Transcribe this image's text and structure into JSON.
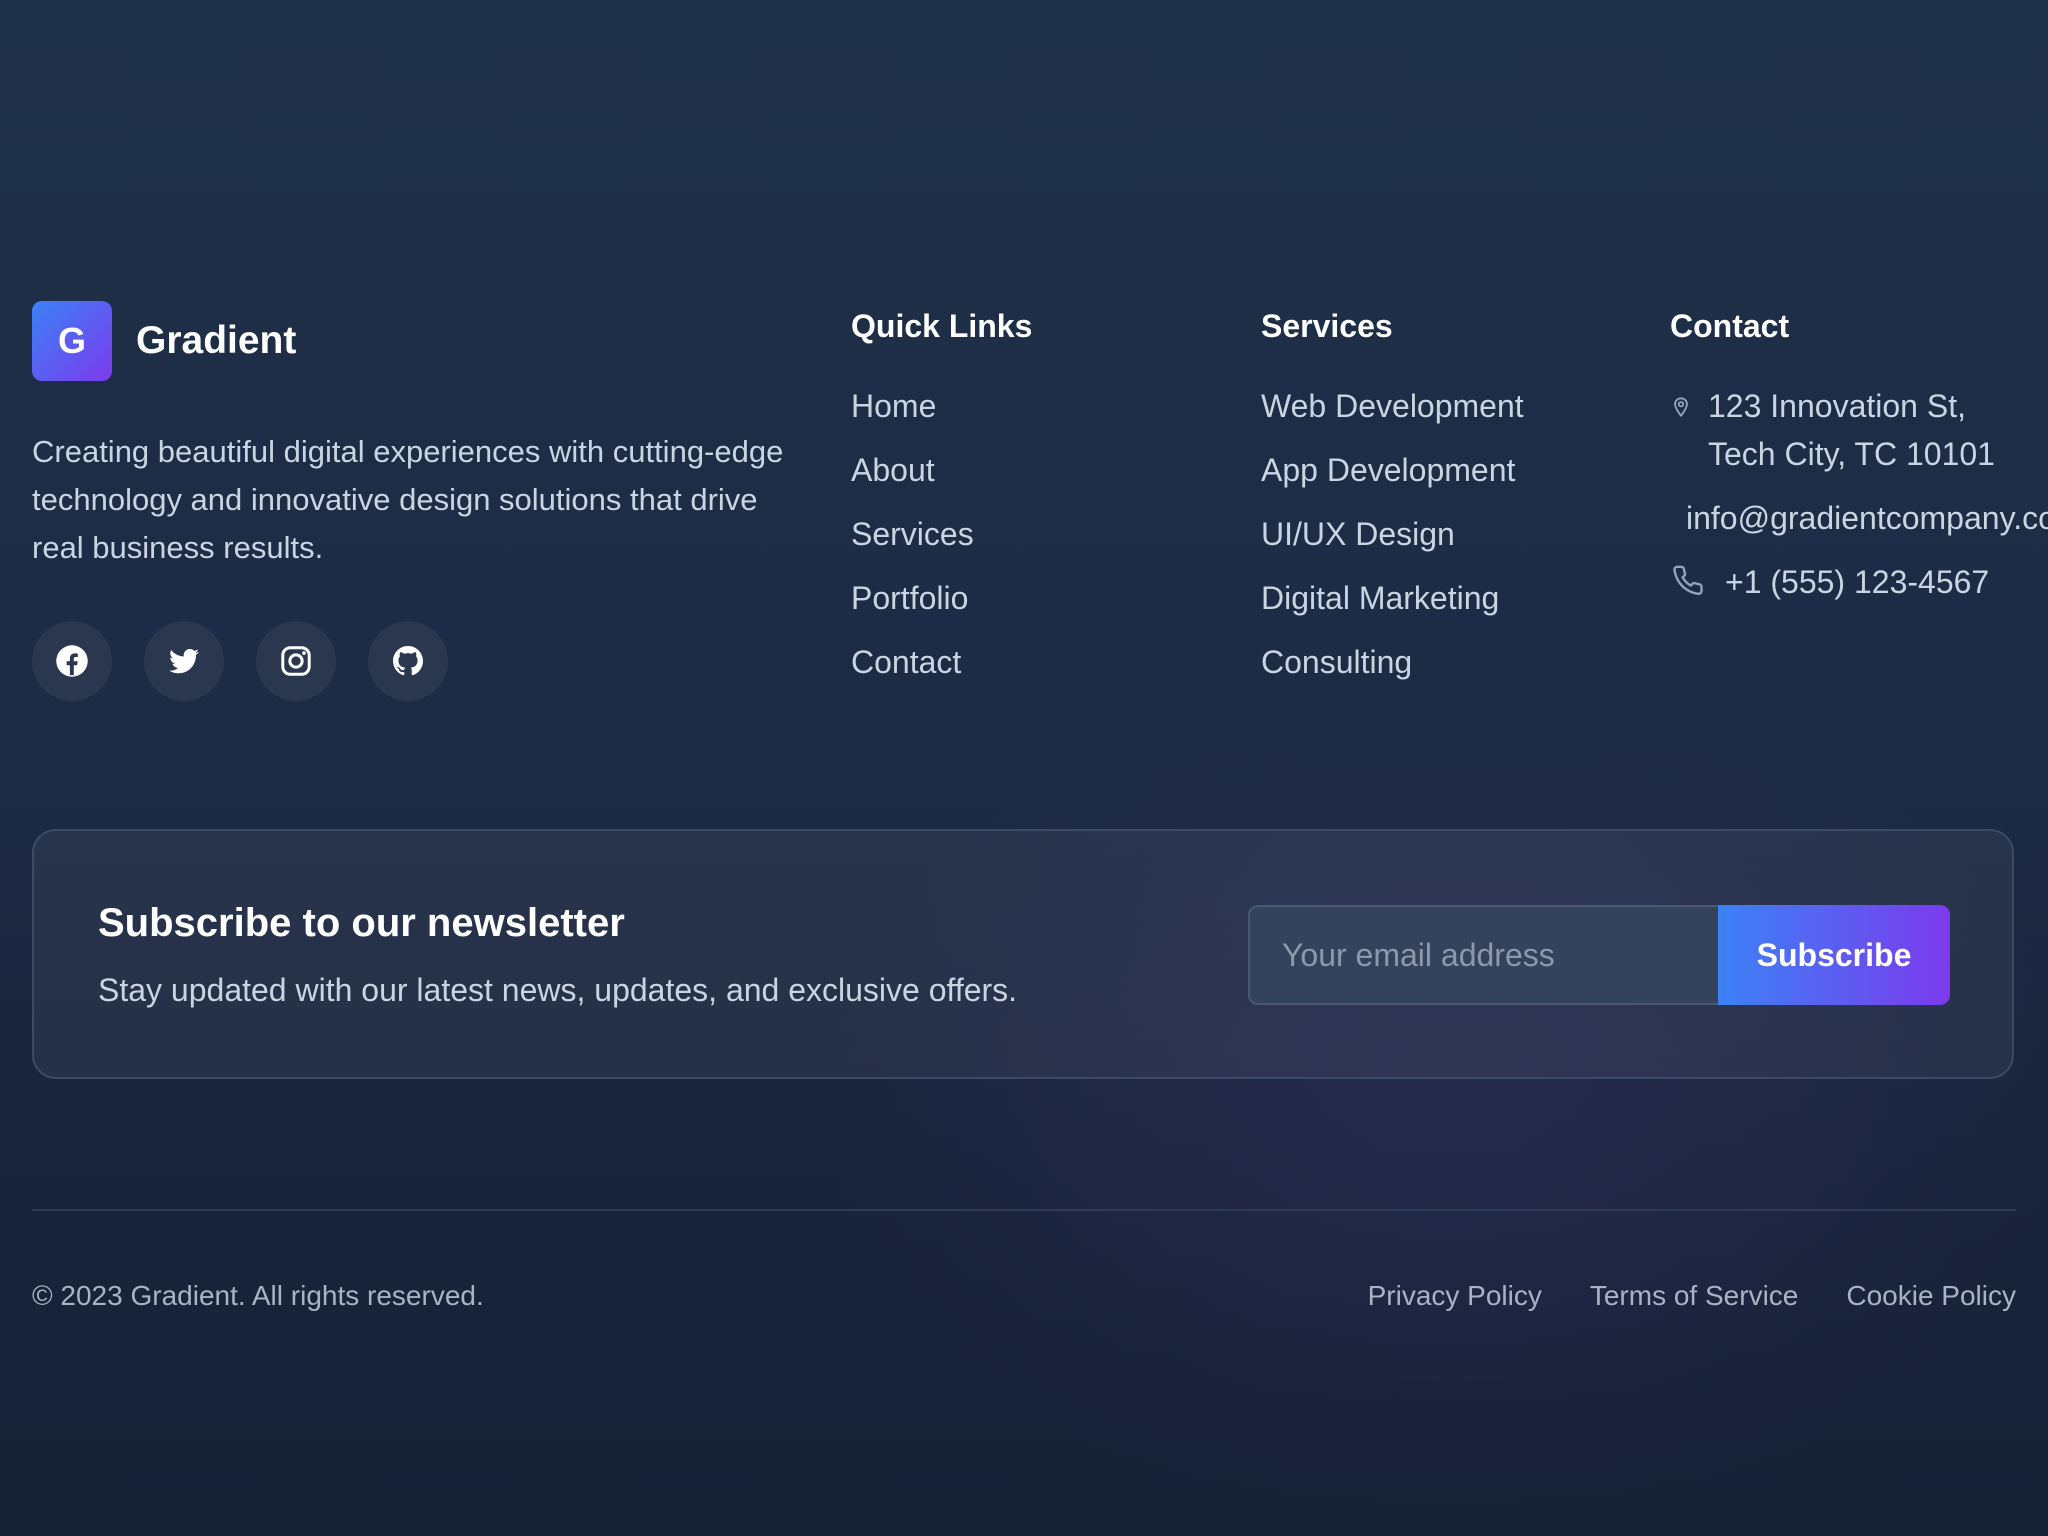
{
  "brand": {
    "logo_letter": "G",
    "name": "Gradient",
    "description": "Creating beautiful digital experiences with cutting-edge technology and innovative design solutions that drive real business results."
  },
  "social": [
    {
      "icon": "facebook-icon"
    },
    {
      "icon": "twitter-icon"
    },
    {
      "icon": "instagram-icon"
    },
    {
      "icon": "github-icon"
    }
  ],
  "quick_links": {
    "title": "Quick Links",
    "items": [
      "Home",
      "About",
      "Services",
      "Portfolio",
      "Contact"
    ]
  },
  "services": {
    "title": "Services",
    "items": [
      "Web Development",
      "App Development",
      "UI/UX Design",
      "Digital Marketing",
      "Consulting"
    ]
  },
  "contact": {
    "title": "Contact",
    "address_line1": "123 Innovation St,",
    "address_line2": "Tech City, TC 10101",
    "email": "info@gradientcompany.com",
    "phone": "+1 (555) 123-4567"
  },
  "newsletter": {
    "title": "Subscribe to our newsletter",
    "subtitle": "Stay updated with our latest news, updates, and exclusive offers.",
    "email_placeholder": "Your email address",
    "button_label": "Subscribe"
  },
  "footer_bottom": {
    "copyright": "© 2023 Gradient. All rights reserved.",
    "links": [
      "Privacy Policy",
      "Terms of Service",
      "Cookie Policy"
    ]
  },
  "colors": {
    "accent_start": "#3b82f6",
    "accent_end": "#7c3aed",
    "background": "#1d2b45"
  }
}
